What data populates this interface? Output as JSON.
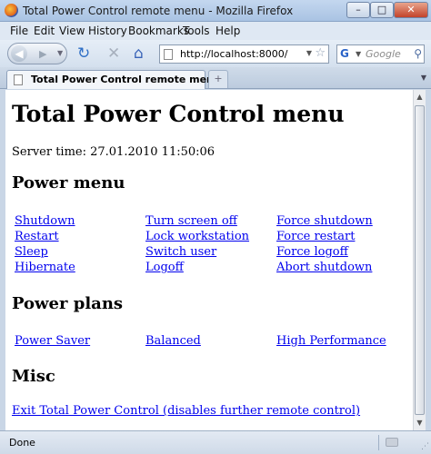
{
  "window": {
    "title": "Total Power Control remote menu - Mozilla Firefox",
    "minimize": "–",
    "maximize": "□",
    "close": "✕"
  },
  "menu": [
    "File",
    "Edit",
    "View",
    "History",
    "Bookmarks",
    "Tools",
    "Help"
  ],
  "nav": {
    "url": "http://localhost:8000/",
    "search_placeholder": "Google"
  },
  "tab": {
    "label": "Total Power Control remote menu",
    "new_tab": "+"
  },
  "page": {
    "title": "Total Power Control menu",
    "server_time": "Server time: 27.01.2010 11:50:06",
    "power_menu": {
      "heading": "Power menu",
      "links": [
        [
          "Shutdown",
          "Turn screen off",
          "Force shutdown"
        ],
        [
          "Restart",
          "Lock workstation",
          "Force restart"
        ],
        [
          "Sleep",
          "Switch user",
          "Force logoff"
        ],
        [
          "Hibernate",
          "Logoff",
          "Abort shutdown"
        ]
      ]
    },
    "power_plans": {
      "heading": "Power plans",
      "links": [
        "Power Saver",
        "Balanced",
        "High Performance"
      ]
    },
    "misc": {
      "heading": "Misc",
      "exit_link": "Exit Total Power Control (disables further remote control)"
    }
  },
  "status": {
    "text": "Done"
  },
  "icons": {
    "back": "back-arrow-icon",
    "forward": "forward-arrow-icon",
    "reload": "reload-icon",
    "stop": "stop-icon",
    "home": "home-icon",
    "bookmark_star": "star-icon",
    "search_engine": "google-icon",
    "search": "magnifier-icon"
  },
  "colors": {
    "link": "#0000ee",
    "chrome": "#c9d6e6"
  }
}
